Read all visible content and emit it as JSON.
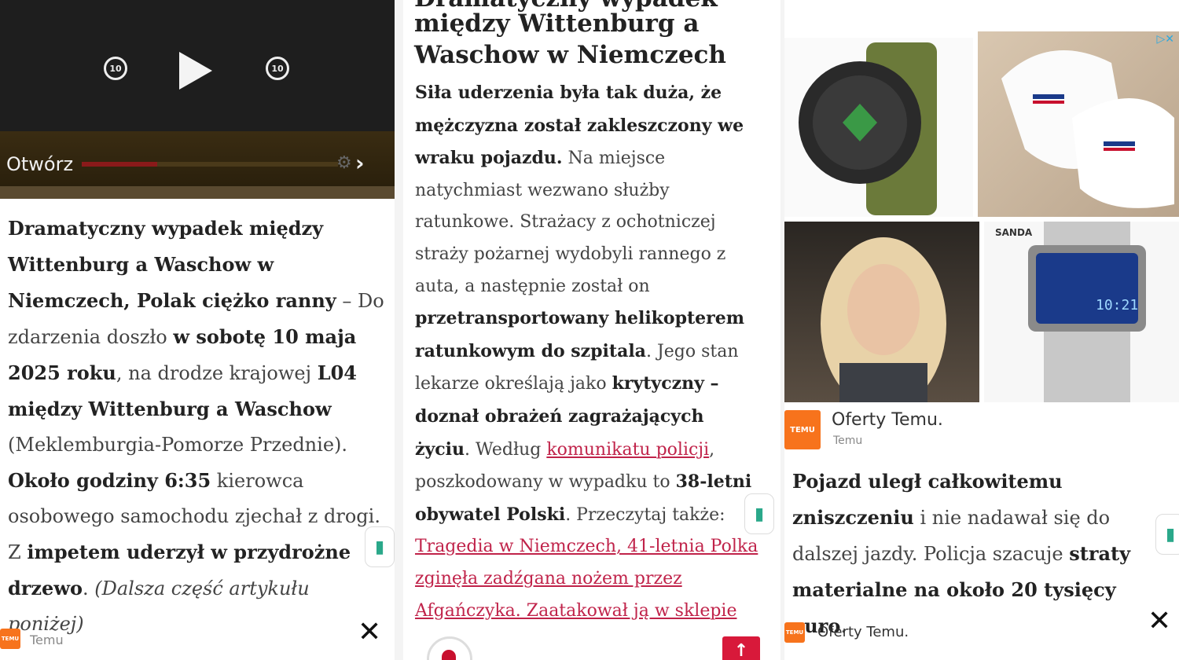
{
  "panel1": {
    "player": {
      "rewind_label": "10",
      "forward_label": "10",
      "open_label": "Otwórz"
    },
    "article": {
      "lead_bold": "Dramatyczny wypadek między Wittenburg a Waschow w Niemczech, Polak ciężko ranny",
      "t1": " – Do zdarzenia doszło ",
      "b1": "w sobotę 10 maja 2025 roku",
      "t2": ", na drodze krajowej ",
      "b2": "L04 między Wittenburg a Waschow",
      "t3": " (Meklemburgia-Pomorze Przednie). ",
      "b3": "Około godziny 6:35",
      "t4": " kierowca osobowego samochodu zjechał z drogi. Z ",
      "b4": "impetem uderzył w przydrożne drzewo",
      "t5": ". ",
      "i1": "(Dalsza część artykułu poniżej)"
    },
    "ad": {
      "brand": "Temu",
      "logo_text": "TEMU"
    }
  },
  "panel2": {
    "headline_partial": "Dramatyczny wypadek",
    "headline": "między Wittenburg a Waschow w Niemczech",
    "article": {
      "b1": "Siła uderzenia była tak duża, że mężczyzna został zakleszczony we wraku pojazdu.",
      "t1": " Na miejsce natychmiast wezwano służby ratunkowe. Strażacy z ochotniczej straży pożarnej wydobyli rannego z auta, a następnie został on ",
      "b2": "przetransportowany helikopterem ratunkowym do szpitala",
      "t2": ". Jego stan lekarze określają jako ",
      "b3": "krytyczny – doznał obrażeń zagrażających życiu",
      "t3": ". Według ",
      "link1": "komunikatu policji",
      "t4": ", poszkodowany w wypadku to ",
      "b4": "38-letni obywatel Polski",
      "t5": ". Przeczytaj także: ",
      "link2": "Tragedia w Niemczech, 41-letnia Polka zginęła zadźgana nożem przez Afgańczyka. Zaatakował ją w sklepie"
    }
  },
  "panel3": {
    "ad": {
      "title": "Oferty Temu.",
      "brand": "Temu",
      "logo_text": "TEMU",
      "watch_brand": "SANDA",
      "watch_time": "10:21"
    },
    "article": {
      "b1": "Pojazd uległ całkowitemu zniszczeniu",
      "t1": " i nie nadawał się do dalszej jazdy. Policja szacuje ",
      "b2": "straty materialne na około 20 tysięcy euro",
      "t2": "."
    },
    "bottom_ad_title": "Oferty Temu."
  },
  "colors": {
    "link": "#c0234a",
    "temu": "#f7731c",
    "accent_red": "#d8193a"
  }
}
